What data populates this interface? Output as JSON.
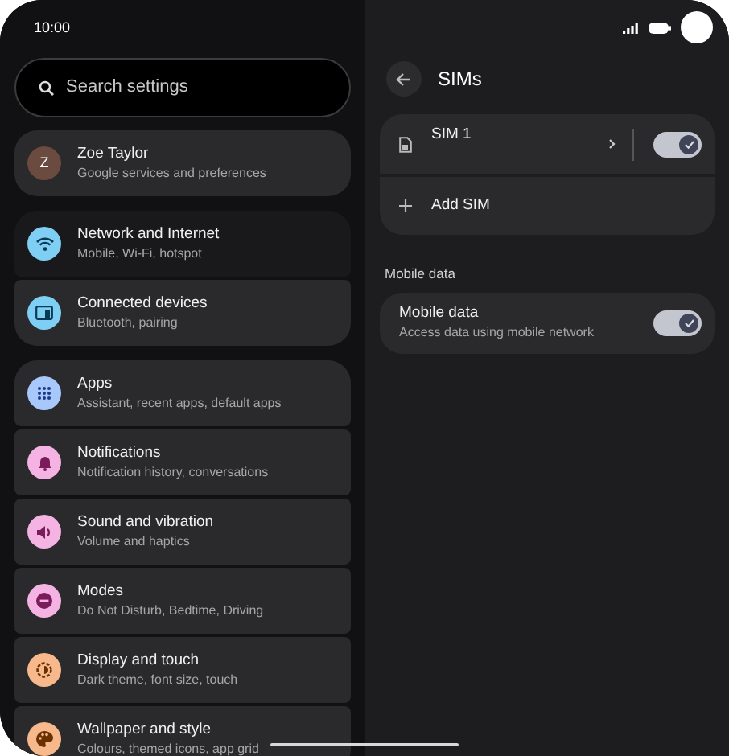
{
  "status_bar": {
    "time": "10:00"
  },
  "search": {
    "placeholder": "Search settings"
  },
  "settings_groups": [
    [
      {
        "kind": "account",
        "avatar": "Z",
        "title": "Zoe Taylor",
        "subtitle": "Google services and preferences",
        "color": "#6b4a3f",
        "selected": false
      }
    ],
    [
      {
        "kind": "network",
        "title": "Network and Internet",
        "subtitle": "Mobile, Wi-Fi, hotspot",
        "color": "#7fcff5",
        "selected": true
      },
      {
        "kind": "devices",
        "title": "Connected devices",
        "subtitle": "Bluetooth, pairing",
        "color": "#7fcff5",
        "selected": false
      }
    ],
    [
      {
        "kind": "apps",
        "title": "Apps",
        "subtitle": "Assistant, recent apps, default apps",
        "color": "#a8c7fa",
        "selected": false
      },
      {
        "kind": "bell",
        "title": "Notifications",
        "subtitle": "Notification history, conversations",
        "color": "#f4b3e2",
        "selected": false
      },
      {
        "kind": "sound",
        "title": "Sound and vibration",
        "subtitle": "Volume and haptics",
        "color": "#f4b3e2",
        "selected": false
      },
      {
        "kind": "modes",
        "title": "Modes",
        "subtitle": "Do Not Disturb, Bedtime, Driving",
        "color": "#f4b3e2",
        "selected": false
      },
      {
        "kind": "display",
        "title": "Display and touch",
        "subtitle": "Dark theme, font size, touch",
        "color": "#f7b98b",
        "selected": false
      },
      {
        "kind": "palette",
        "title": "Wallpaper and style",
        "subtitle": "Colours, themed icons, app grid",
        "color": "#f7b98b",
        "selected": false
      }
    ]
  ],
  "detail": {
    "title": "SIMs",
    "sim_rows": [
      {
        "kind": "sim",
        "label": "SIM 1",
        "checked": true
      },
      {
        "kind": "add",
        "label": "Add SIM"
      }
    ],
    "section_header": "Mobile data",
    "toggles": [
      {
        "title": "Mobile data",
        "subtitle": "Access data using mobile network",
        "checked": true
      }
    ]
  }
}
